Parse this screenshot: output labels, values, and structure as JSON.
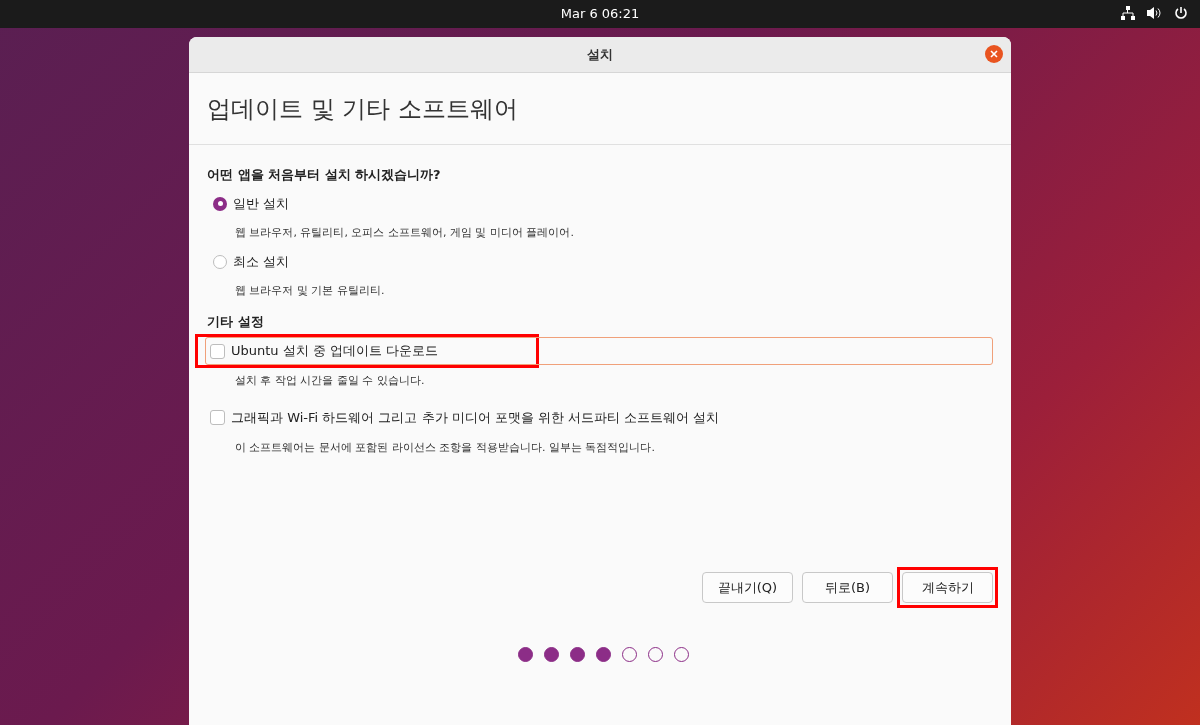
{
  "top_bar": {
    "clock": "Mar 6  06:21"
  },
  "window": {
    "title": "설치"
  },
  "page_title": "업데이트 및 기타 소프트웨어",
  "question": "어떤 앱을 처음부터 설치 하시겠습니까?",
  "install_options": [
    {
      "label": "일반 설치",
      "description": "웹 브라우저, 유틸리티, 오피스  소프트웨어, 게임 및 미디어 플레이어.",
      "selected": true
    },
    {
      "label": "최소 설치",
      "description": "웹 브라우저 및 기본 유틸리티.",
      "selected": false
    }
  ],
  "other_heading": "기타 설정",
  "other_options": [
    {
      "label": "Ubuntu 설치 중 업데이트 다운로드",
      "description": "설치 후 작업 시간을 줄일 수 있습니다.",
      "checked": false,
      "focused": true,
      "highlighted": true
    },
    {
      "label": "그래픽과 Wi-Fi 하드웨어 그리고 추가 미디어 포맷을 위한 서드파티 소프트웨어 설치",
      "description": "이 소프트웨어는 문서에 포함된 라이선스 조항을 적용받습니다. 일부는 독점적입니다.",
      "checked": false,
      "focused": false,
      "highlighted": false
    }
  ],
  "buttons": [
    {
      "label": "끝내기(Q)",
      "highlighted": false
    },
    {
      "label": "뒤로(B)",
      "highlighted": false
    },
    {
      "label": "계속하기",
      "highlighted": true
    }
  ],
  "progress_steps": [
    {
      "filled": true
    },
    {
      "filled": true
    },
    {
      "filled": true
    },
    {
      "filled": true
    },
    {
      "filled": false
    },
    {
      "filled": false
    },
    {
      "filled": false
    }
  ]
}
